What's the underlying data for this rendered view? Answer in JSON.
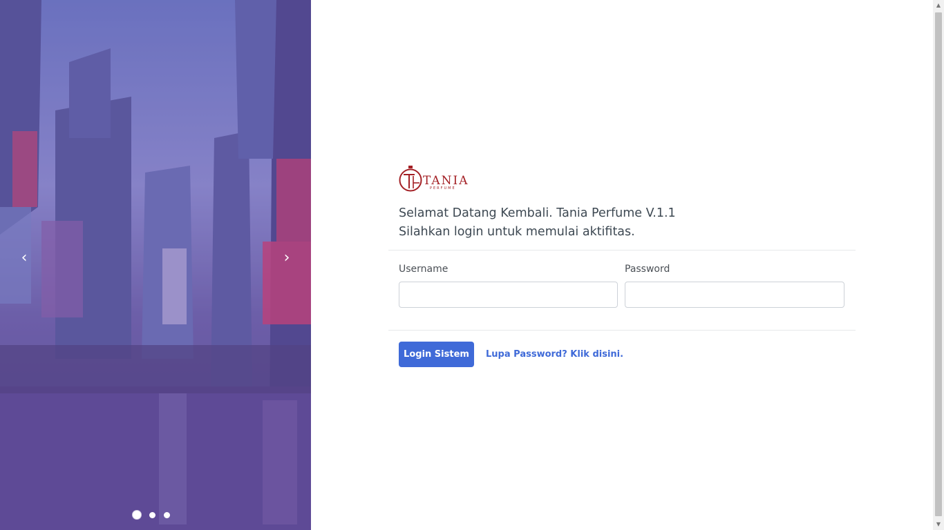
{
  "carousel": {
    "prev_icon": "chevron-left-icon",
    "next_icon": "chevron-right-icon",
    "prev_glyph": "‹",
    "next_glyph": "›",
    "slides": 3,
    "active_slide": 1
  },
  "brand": {
    "name": "TANIA",
    "tagline": "PERFUME",
    "monogram": "TH",
    "color": "#a31f24"
  },
  "welcome": {
    "line1": "Selamat Datang Kembali. Tania Perfume V.1.1",
    "line2": "Silahkan login untuk memulai aktifitas."
  },
  "form": {
    "username_label": "Username",
    "username_value": "",
    "password_label": "Password",
    "password_value": "",
    "login_button": "Login Sistem",
    "forgot_link": "Lupa Password? Klik disini."
  },
  "colors": {
    "accent": "#3f6ad8",
    "overlay": "#6b5aa7"
  }
}
